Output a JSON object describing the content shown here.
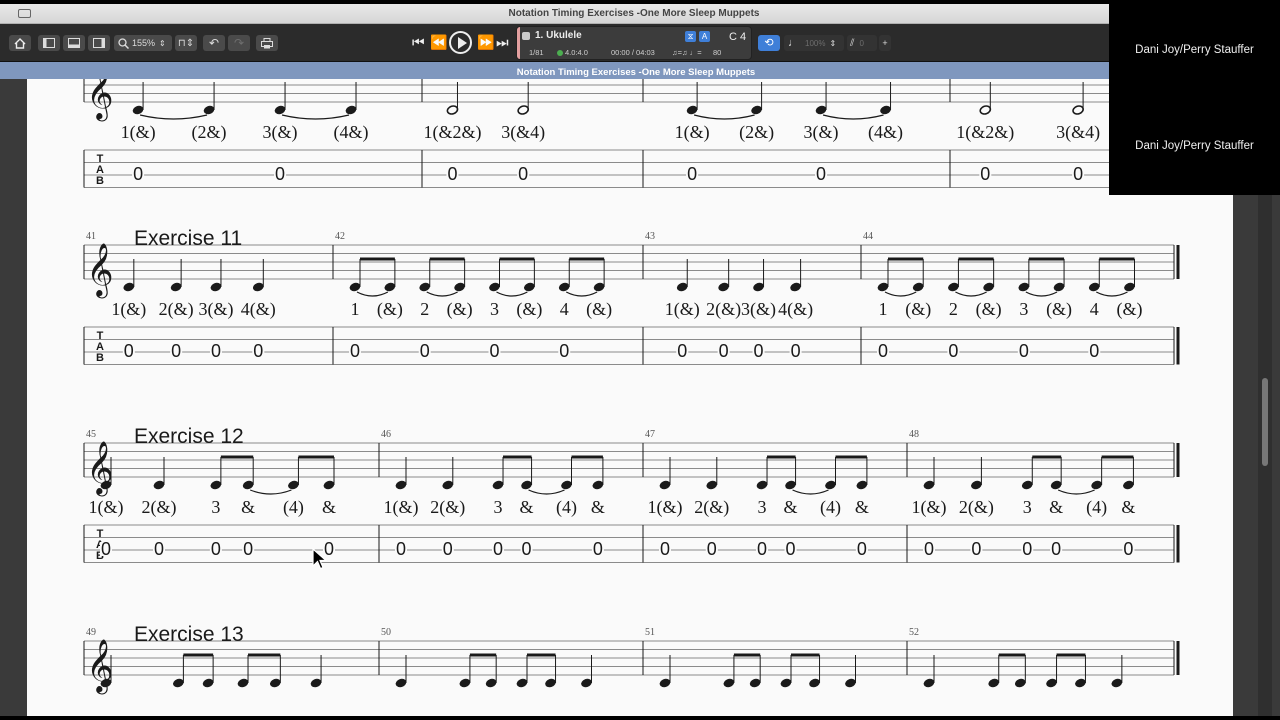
{
  "window": {
    "title": "Notation Timing Exercises -One More Sleep Muppets"
  },
  "toolbar": {
    "zoom": "155%",
    "track_name": "1. Ukulele",
    "bar_position": "1/81",
    "tempo_info": "4.0:4.0",
    "time_position": "00:00 / 04:03",
    "tempo_value": "80",
    "key": "C 4",
    "volume": "100%",
    "tuning_value": "0"
  },
  "doc_header": {
    "title": "Notation Timing Exercises -One More Sleep Muppets"
  },
  "score": {
    "tab_label": "TAB",
    "systems": [
      {
        "title": "",
        "bars": [
          {
            "number": "",
            "counts": [
              "1(&)",
              "(2&)",
              "3(&)",
              "(4&)"
            ],
            "tab": [
              "0",
              "0"
            ]
          },
          {
            "number": "",
            "counts": [
              "1(&2&)",
              "3(&4)"
            ],
            "tab": [
              "0",
              "0"
            ]
          },
          {
            "number": "",
            "counts": [
              "1(&)",
              "(2&)",
              "3(&)",
              "(4&)"
            ],
            "tab": [
              "0",
              "0"
            ]
          },
          {
            "number": "",
            "counts": [
              "1(&2&)",
              "3(&4)"
            ],
            "tab": [
              "0",
              "0"
            ]
          }
        ]
      },
      {
        "title": "Exercise 11",
        "bars": [
          {
            "number": "41",
            "counts": [
              "1(&)",
              "2(&)",
              "3(&)",
              "4(&)"
            ],
            "tab": [
              "0",
              "0",
              "0",
              "0"
            ]
          },
          {
            "number": "42",
            "counts": [
              "1",
              "(&)",
              "2",
              "(&)",
              "3",
              "(&)",
              "4",
              "(&)"
            ],
            "tab": [
              "0",
              "0",
              "0",
              "0"
            ]
          },
          {
            "number": "43",
            "counts": [
              "1(&)",
              "2(&)",
              "3(&)",
              "4(&)"
            ],
            "tab": [
              "0",
              "0",
              "0",
              "0"
            ]
          },
          {
            "number": "44",
            "counts": [
              "1",
              "(&)",
              "2",
              "(&)",
              "3",
              "(&)",
              "4",
              "(&)"
            ],
            "tab": [
              "0",
              "0",
              "0",
              "0"
            ]
          }
        ]
      },
      {
        "title": "Exercise 12",
        "bars": [
          {
            "number": "45",
            "counts": [
              "1(&)",
              "2(&)",
              "3",
              "&",
              "(4)",
              "&"
            ],
            "tab": [
              "0",
              "0",
              "0",
              "0",
              "0"
            ]
          },
          {
            "number": "46",
            "counts": [
              "1(&)",
              "2(&)",
              "3",
              "&",
              "(4)",
              "&"
            ],
            "tab": [
              "0",
              "0",
              "0",
              "0",
              "0"
            ]
          },
          {
            "number": "47",
            "counts": [
              "1(&)",
              "2(&)",
              "3",
              "&",
              "(4)",
              "&"
            ],
            "tab": [
              "0",
              "0",
              "0",
              "0",
              "0"
            ]
          },
          {
            "number": "48",
            "counts": [
              "1(&)",
              "2(&)",
              "3",
              "&",
              "(4)",
              "&"
            ],
            "tab": [
              "0",
              "0",
              "0",
              "0",
              "0"
            ]
          }
        ]
      },
      {
        "title": "Exercise 13",
        "bars": [
          {
            "number": "49"
          },
          {
            "number": "50"
          },
          {
            "number": "51"
          },
          {
            "number": "52"
          }
        ]
      }
    ]
  },
  "video": {
    "participants": [
      "Dani Joy/Perry Stauffer",
      "Dani Joy/Perry Stauffer"
    ]
  }
}
